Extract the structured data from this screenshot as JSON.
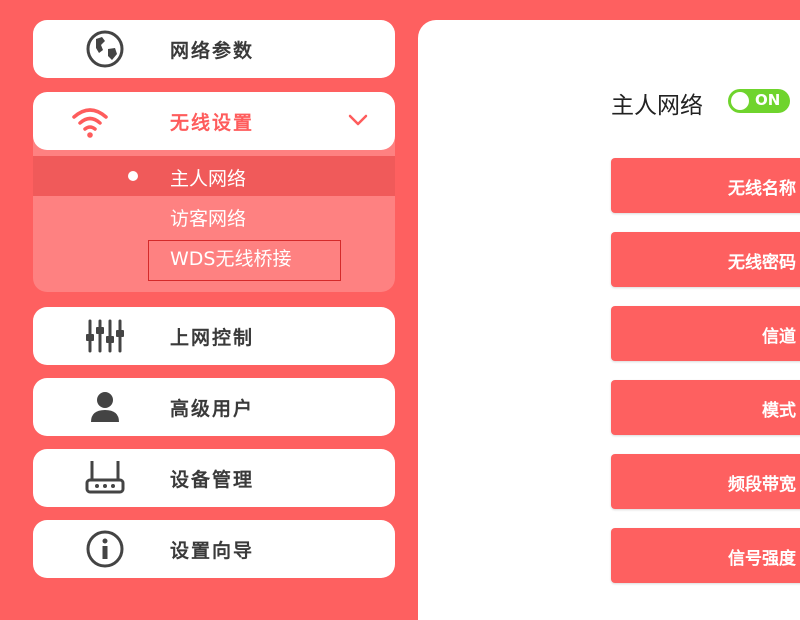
{
  "sidebar": {
    "network_params": "网络参数",
    "wireless": {
      "label": "无线设置",
      "sub_items": [
        "主人网络",
        "访客网络",
        "WDS无线桥接"
      ]
    },
    "internet_control": "上网控制",
    "advanced_users": "高级用户",
    "device_management": "设备管理",
    "setup_wizard": "设置向导"
  },
  "main": {
    "title": "主人网络",
    "toggle": "ON",
    "fields": [
      "无线名称",
      "无线密码",
      "信道",
      "模式",
      "频段带宽",
      "信号强度"
    ]
  },
  "colors": {
    "accent": "#fe6060",
    "toggle": "#6fd42d",
    "highlight_box": "#d42a2a"
  }
}
